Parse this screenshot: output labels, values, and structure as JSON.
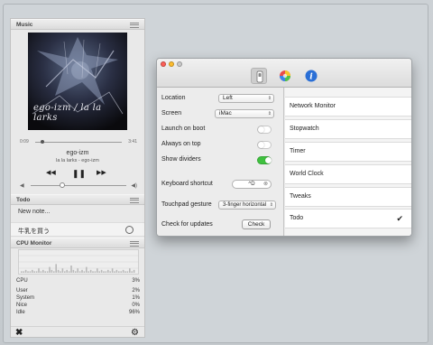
{
  "music": {
    "header": "Music",
    "album_text": "ego-izm / la la larks",
    "time_elapsed": "0:09",
    "time_total": "3:41",
    "seek_progress": 0.06,
    "volume_level": 0.33,
    "title": "ego-izm",
    "subtitle": "la la larks - ego-izm",
    "prev_glyph": "◀◀",
    "pause_glyph": "❚❚",
    "next_glyph": "▶▶",
    "vol_low_glyph": "◀",
    "vol_high_glyph": "◀)"
  },
  "todo": {
    "header": "Todo",
    "new_placeholder": "New note...",
    "items": [
      {
        "text": "牛乳を買う"
      }
    ]
  },
  "cpu": {
    "header": "CPU Monitor",
    "rows": [
      {
        "label": "CPU",
        "value": "3%"
      },
      {
        "label": "User",
        "value": "2%"
      },
      {
        "label": "System",
        "value": "1%"
      },
      {
        "label": "Nice",
        "value": "0%"
      },
      {
        "label": "Idle",
        "value": "96%"
      }
    ]
  },
  "bottom": {
    "close_glyph": "✖",
    "gear_glyph": "⚙"
  },
  "prefs": {
    "settings": {
      "location_label": "Location",
      "location_value": "Left",
      "screen_label": "Screen",
      "screen_value": "iMac",
      "launch_label": "Launch on boot",
      "launch_on": false,
      "ontop_label": "Always on top",
      "ontop_on": false,
      "dividers_label": "Show dividers",
      "dividers_on": true,
      "shortcut_label": "Keyboard shortcut",
      "shortcut_value": "^D",
      "gesture_label": "Touchpad gesture",
      "gesture_value": "3-finger horizontal",
      "updates_label": "Check for updates",
      "check_button": "Check"
    },
    "toolbar_info_glyph": "i",
    "widgets": [
      {
        "name": "Network Monitor",
        "checked": false
      },
      {
        "name": "Stopwatch",
        "checked": false
      },
      {
        "name": "Timer",
        "checked": false
      },
      {
        "name": "World Clock",
        "checked": false
      },
      {
        "name": "Tweaks",
        "checked": false
      },
      {
        "name": "Todo",
        "checked": true
      }
    ],
    "check_glyph": "✔"
  },
  "colors": {
    "toggle_on": "#3fc13f",
    "close_red": "#fc5f57",
    "min_yellow": "#fdbc2e",
    "max_green": "#c9c9c9",
    "info_blue": "#2a6fd6"
  }
}
